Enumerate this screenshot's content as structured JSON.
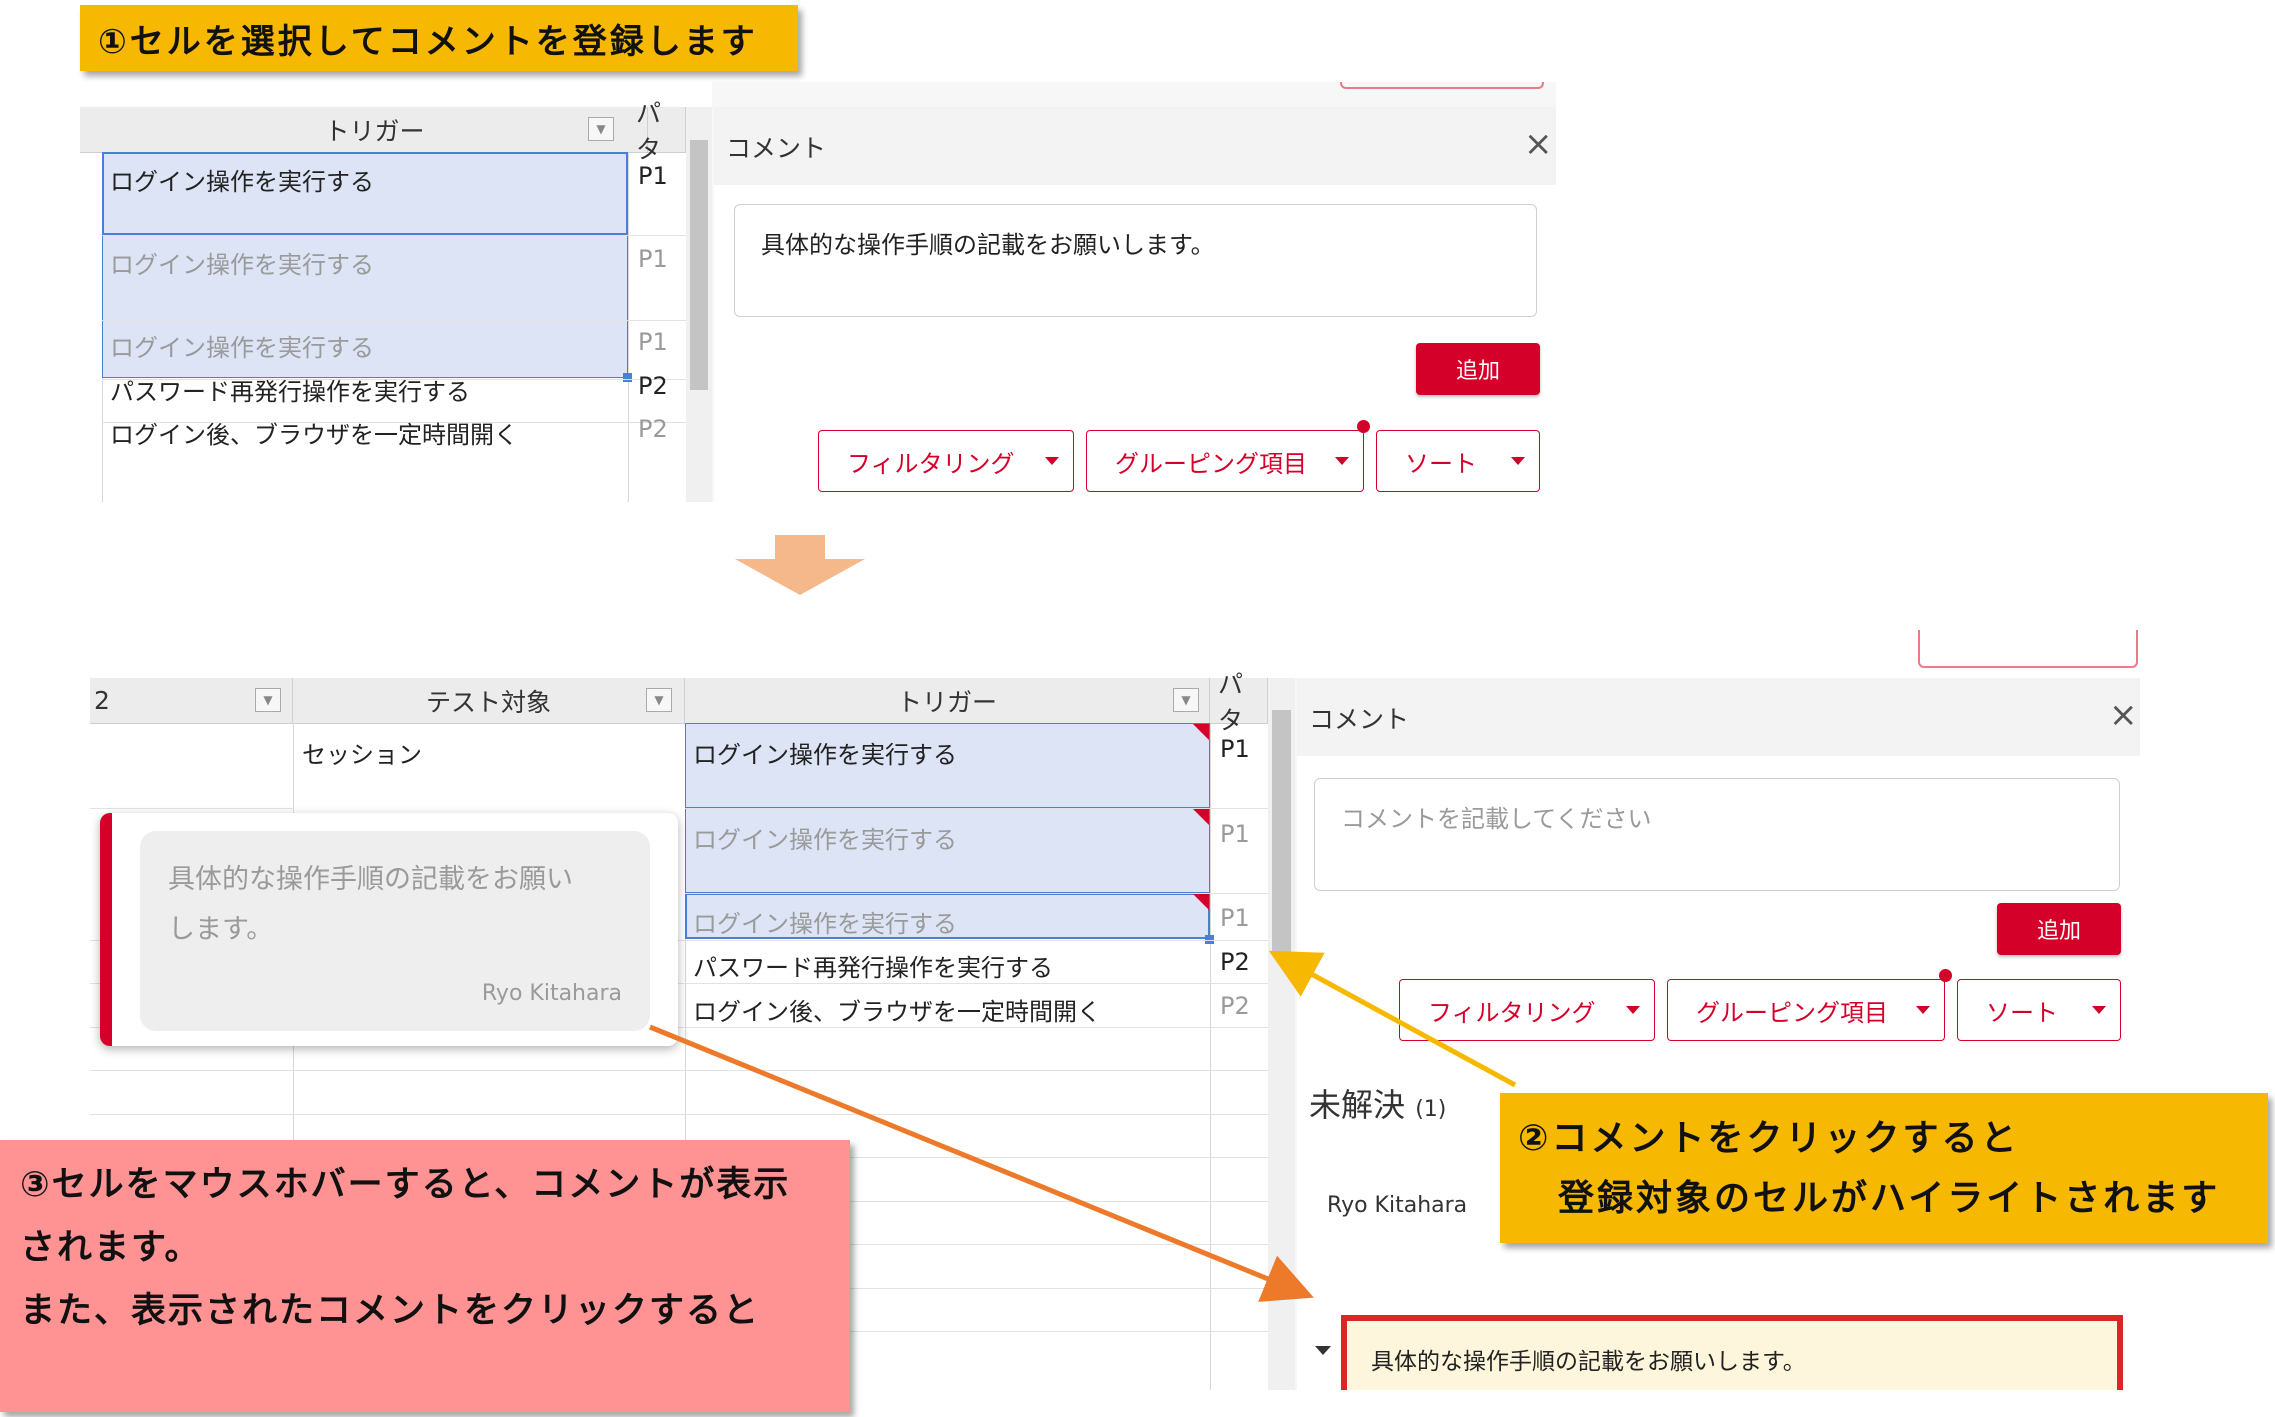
{
  "callout1": "①セルを選択してコメントを登録します",
  "callout2_line1": "②コメントをクリックすると",
  "callout2_line2": "登録対象のセルがハイライトされます",
  "callout3_line1": "③セルをマウスホバーすると、コメントが表示",
  "callout3_line2": "されます。",
  "callout3_line3": "また、表示されたコメントをクリックすると",
  "top": {
    "col_trigger": "トリガー",
    "col_pattern": "パタ",
    "rows": [
      {
        "trigger": "ログイン操作を実行する",
        "pattern": "P1"
      },
      {
        "trigger": "ログイン操作を実行する",
        "pattern": "P1"
      },
      {
        "trigger": "ログイン操作を実行する",
        "pattern": "P1"
      },
      {
        "trigger": "パスワード再発行操作を実行する",
        "pattern": "P2"
      },
      {
        "trigger": "ログイン後、ブラウザを一定時間開く",
        "pattern": "P2"
      }
    ],
    "comment_title": "コメント",
    "comment_text": "具体的な操作手順の記載をお願いします。",
    "add_label": "追加",
    "filter_label": "フィルタリング",
    "group_label": "グルーピング項目",
    "sort_label": "ソート"
  },
  "bottom": {
    "col_2": "2",
    "col_target": "テスト対象",
    "col_trigger": "トリガー",
    "col_pattern": "パタ",
    "target_cell": "セッション",
    "rows": [
      {
        "trigger": "ログイン操作を実行する",
        "pattern": "P1"
      },
      {
        "trigger": "ログイン操作を実行する",
        "pattern": "P1"
      },
      {
        "trigger": "ログイン操作を実行する",
        "pattern": "P1"
      },
      {
        "trigger": "パスワード再発行操作を実行する",
        "pattern": "P2"
      },
      {
        "trigger": "ログイン後、ブラウザを一定時間開く",
        "pattern": "P2"
      }
    ],
    "hover_text_line1": "具体的な操作手順の記載をお願い",
    "hover_text_line2": "します。",
    "hover_author": "Ryo Kitahara",
    "comment_title": "コメント",
    "comment_placeholder": "コメントを記載してください",
    "add_label": "追加",
    "filter_label": "フィルタリング",
    "group_label": "グルーピング項目",
    "sort_label": "ソート",
    "unresolved_label": "未解決",
    "unresolved_count": "(1)",
    "author": "Ryo Kitahara",
    "comment_text": "具体的な操作手順の記載をお願いします。"
  }
}
